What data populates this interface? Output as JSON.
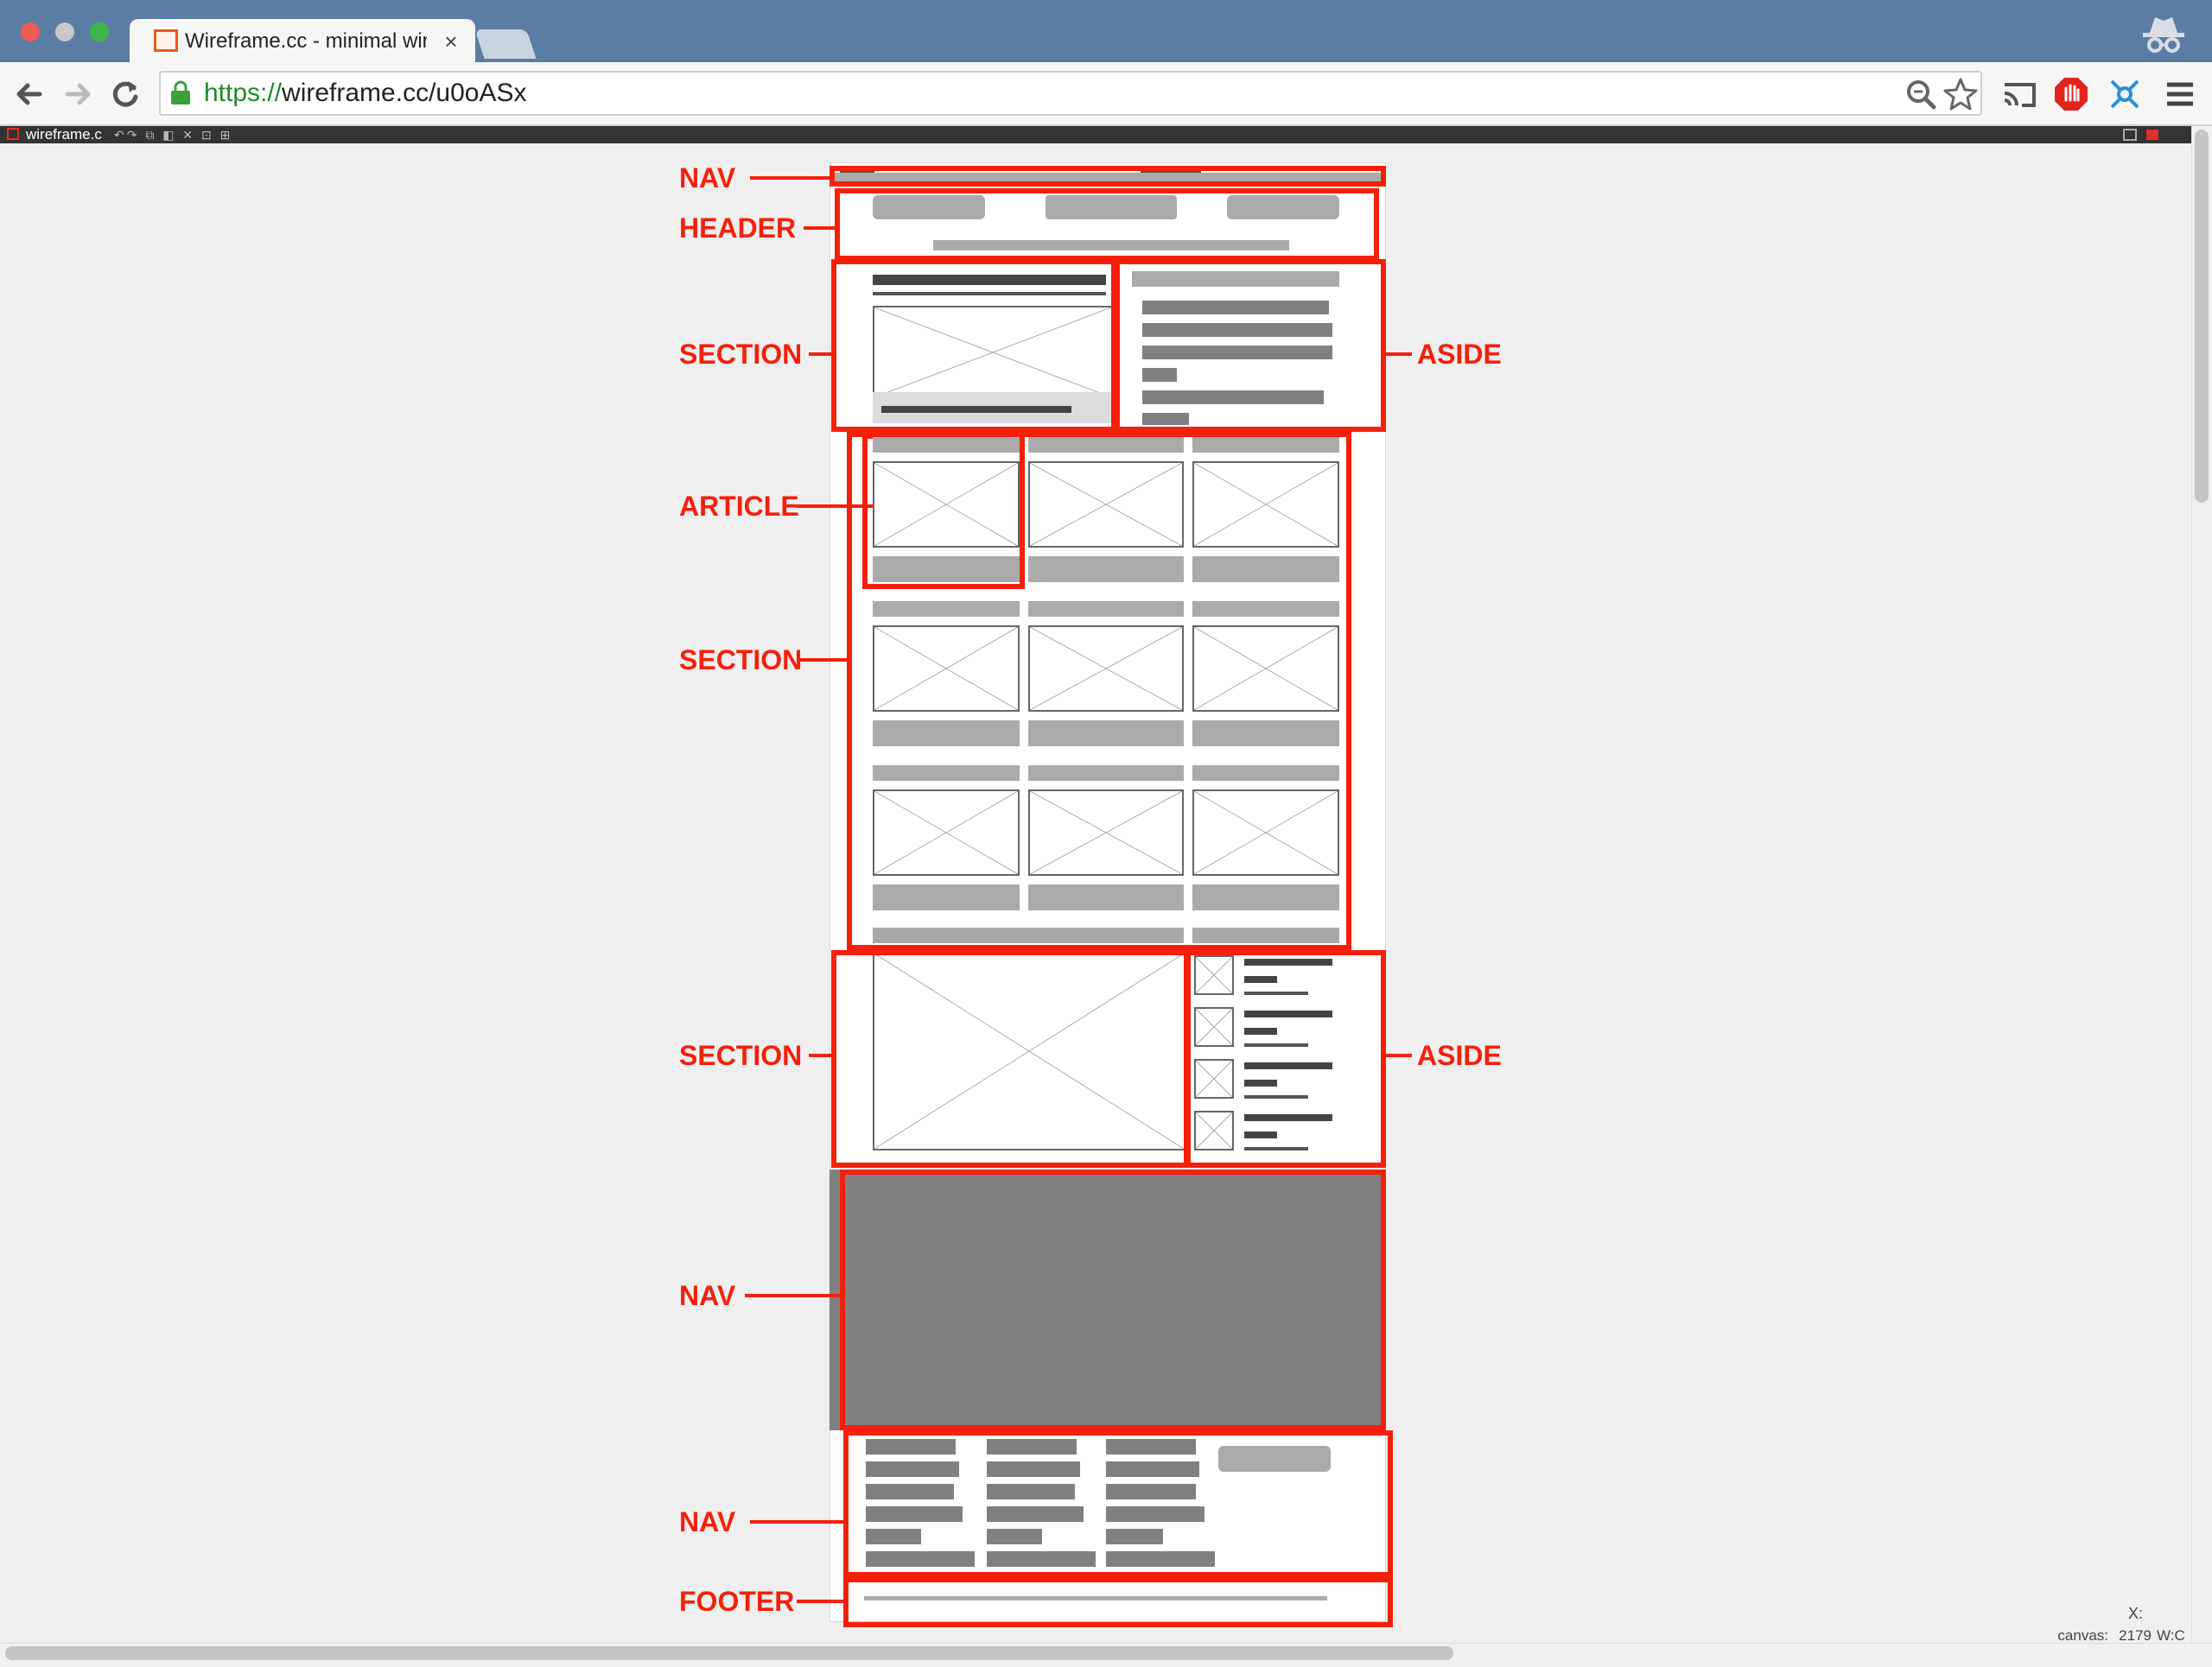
{
  "browser": {
    "tab_title": "Wireframe.cc - minimal wire",
    "tab_close": "×",
    "url_scheme": "https://",
    "url_rest": "wireframe.cc/u0oASx",
    "back_icon": "back-arrow-icon",
    "forward_icon": "forward-arrow-icon",
    "reload_icon": "reload-icon",
    "accent_traffic": [
      "#ee5c52",
      "#c8c8c8",
      "#3fb64a"
    ]
  },
  "appbar": {
    "label": "wireframe.c",
    "tools": "↶↷ ⧉ ◧ ✕ ⊡ ⊞"
  },
  "labels": {
    "nav_top": "NAV",
    "header": "HEADER",
    "section_1": "SECTION",
    "aside_1": "ASIDE",
    "article": "ARTICLE",
    "section_2": "SECTION",
    "section_3": "SECTION",
    "aside_2": "ASIDE",
    "nav_mid": "NAV",
    "nav_bottom": "NAV",
    "footer": "FOOTER"
  },
  "status": {
    "x_label": "X:",
    "canvas_label": "canvas:",
    "x_value": "2179",
    "w_label": "W:C"
  },
  "colors": {
    "annotation": "#f4200b",
    "titlebar": "#5c7da3"
  }
}
